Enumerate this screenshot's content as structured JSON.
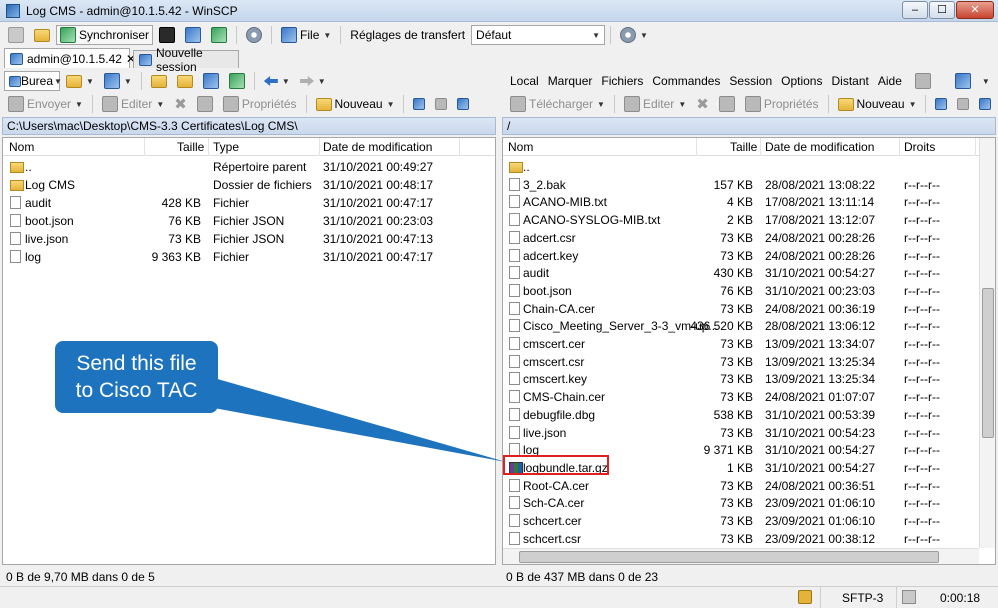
{
  "window": {
    "title": "Log CMS - admin@10.1.5.42 - WinSCP",
    "min": "–",
    "max": "☐",
    "close": "✕"
  },
  "toolbar": {
    "synchroniser": "Synchroniser",
    "file": "File",
    "reglages_label": "Réglages de transfert",
    "reglages_value": "Défaut"
  },
  "tabs": [
    {
      "label": "admin@10.1.5.42"
    },
    {
      "label": "Nouvelle session"
    }
  ],
  "left": {
    "drive": "Burea",
    "actions": {
      "envoyer": "Envoyer",
      "editer": "Editer",
      "proprietes": "Propriétés",
      "nouveau": "Nouveau"
    },
    "path": "C:\\Users\\mac\\Desktop\\CMS-3.3 Certificates\\Log CMS\\",
    "columns": {
      "name": "Nom",
      "size": "Taille",
      "type": "Type",
      "date": "Date de modification"
    },
    "files": [
      {
        "name": "..",
        "size": "",
        "type": "Répertoire parent",
        "date": "31/10/2021  00:49:27",
        "icon": "up"
      },
      {
        "name": "Log CMS",
        "size": "",
        "type": "Dossier de fichiers",
        "date": "31/10/2021  00:48:17",
        "icon": "folder"
      },
      {
        "name": "audit",
        "size": "428 KB",
        "type": "Fichier",
        "date": "31/10/2021  00:47:17",
        "icon": "file"
      },
      {
        "name": "boot.json",
        "size": "76 KB",
        "type": "Fichier JSON",
        "date": "31/10/2021  00:23:03",
        "icon": "file"
      },
      {
        "name": "live.json",
        "size": "73 KB",
        "type": "Fichier JSON",
        "date": "31/10/2021  00:47:13",
        "icon": "file"
      },
      {
        "name": "log",
        "size": "9 363 KB",
        "type": "Fichier",
        "date": "31/10/2021  00:47:17",
        "icon": "file"
      }
    ],
    "status": "0 B de 9,70 MB dans 0 de 5"
  },
  "right": {
    "menu": [
      "Local",
      "Marquer",
      "Fichiers",
      "Commandes",
      "Session",
      "Options",
      "Distant",
      "Aide"
    ],
    "actions": {
      "telecharger": "Télécharger",
      "editer": "Editer",
      "proprietes": "Propriétés",
      "nouveau": "Nouveau"
    },
    "path": "/",
    "columns": {
      "name": "Nom",
      "size": "Taille",
      "date": "Date de modification",
      "rights": "Droits"
    },
    "files": [
      {
        "name": "..",
        "size": "",
        "date": "",
        "rights": "",
        "icon": "up"
      },
      {
        "name": "3_2.bak",
        "size": "157 KB",
        "date": "28/08/2021 13:08:22",
        "rights": "r--r--r--",
        "icon": "file"
      },
      {
        "name": "ACANO-MIB.txt",
        "size": "4 KB",
        "date": "17/08/2021 13:11:14",
        "rights": "r--r--r--",
        "icon": "file"
      },
      {
        "name": "ACANO-SYSLOG-MIB.txt",
        "size": "2 KB",
        "date": "17/08/2021 13:12:07",
        "rights": "r--r--r--",
        "icon": "file"
      },
      {
        "name": "adcert.csr",
        "size": "73 KB",
        "date": "24/08/2021 00:28:26",
        "rights": "r--r--r--",
        "icon": "file"
      },
      {
        "name": "adcert.key",
        "size": "73 KB",
        "date": "24/08/2021 00:28:26",
        "rights": "r--r--r--",
        "icon": "file"
      },
      {
        "name": "audit",
        "size": "430 KB",
        "date": "31/10/2021 00:54:27",
        "rights": "r--r--r--",
        "icon": "file"
      },
      {
        "name": "boot.json",
        "size": "76 KB",
        "date": "31/10/2021 00:23:03",
        "rights": "r--r--r--",
        "icon": "file"
      },
      {
        "name": "Chain-CA.cer",
        "size": "73 KB",
        "date": "24/08/2021 00:36:19",
        "rights": "r--r--r--",
        "icon": "file"
      },
      {
        "name": "Cisco_Meeting_Server_3-3_vm-up...",
        "size": "436 520 KB",
        "date": "28/08/2021 13:06:12",
        "rights": "r--r--r--",
        "icon": "file"
      },
      {
        "name": "cmscert.cer",
        "size": "73 KB",
        "date": "13/09/2021 13:34:07",
        "rights": "r--r--r--",
        "icon": "file"
      },
      {
        "name": "cmscert.csr",
        "size": "73 KB",
        "date": "13/09/2021 13:25:34",
        "rights": "r--r--r--",
        "icon": "file"
      },
      {
        "name": "cmscert.key",
        "size": "73 KB",
        "date": "13/09/2021 13:25:34",
        "rights": "r--r--r--",
        "icon": "file"
      },
      {
        "name": "CMS-Chain.cer",
        "size": "73 KB",
        "date": "24/08/2021 01:07:07",
        "rights": "r--r--r--",
        "icon": "file"
      },
      {
        "name": "debugfile.dbg",
        "size": "538 KB",
        "date": "31/10/2021 00:53:39",
        "rights": "r--r--r--",
        "icon": "file"
      },
      {
        "name": "live.json",
        "size": "73 KB",
        "date": "31/10/2021 00:54:23",
        "rights": "r--r--r--",
        "icon": "file"
      },
      {
        "name": "log",
        "size": "9 371 KB",
        "date": "31/10/2021 00:54:27",
        "rights": "r--r--r--",
        "icon": "file"
      },
      {
        "name": "logbundle.tar.gz",
        "size": "1 KB",
        "date": "31/10/2021 00:54:27",
        "rights": "r--r--r--",
        "icon": "gz"
      },
      {
        "name": "Root-CA.cer",
        "size": "73 KB",
        "date": "24/08/2021 00:36:51",
        "rights": "r--r--r--",
        "icon": "file"
      },
      {
        "name": "Sch-CA.cer",
        "size": "73 KB",
        "date": "23/09/2021 01:06:10",
        "rights": "r--r--r--",
        "icon": "file"
      },
      {
        "name": "schcert.cer",
        "size": "73 KB",
        "date": "23/09/2021 01:06:10",
        "rights": "r--r--r--",
        "icon": "file"
      },
      {
        "name": "schcert.csr",
        "size": "73 KB",
        "date": "23/09/2021 00:38:12",
        "rights": "r--r--r--",
        "icon": "file"
      }
    ],
    "status": "0 B de 437 MB dans 0 de 23"
  },
  "statusbar": {
    "protocol": "SFTP-3",
    "time": "0:00:18"
  },
  "callout": {
    "line1": "Send this file",
    "line2": "to Cisco TAC"
  },
  "colors": {
    "callout": "#1e73be",
    "highlight": "#e02020"
  }
}
